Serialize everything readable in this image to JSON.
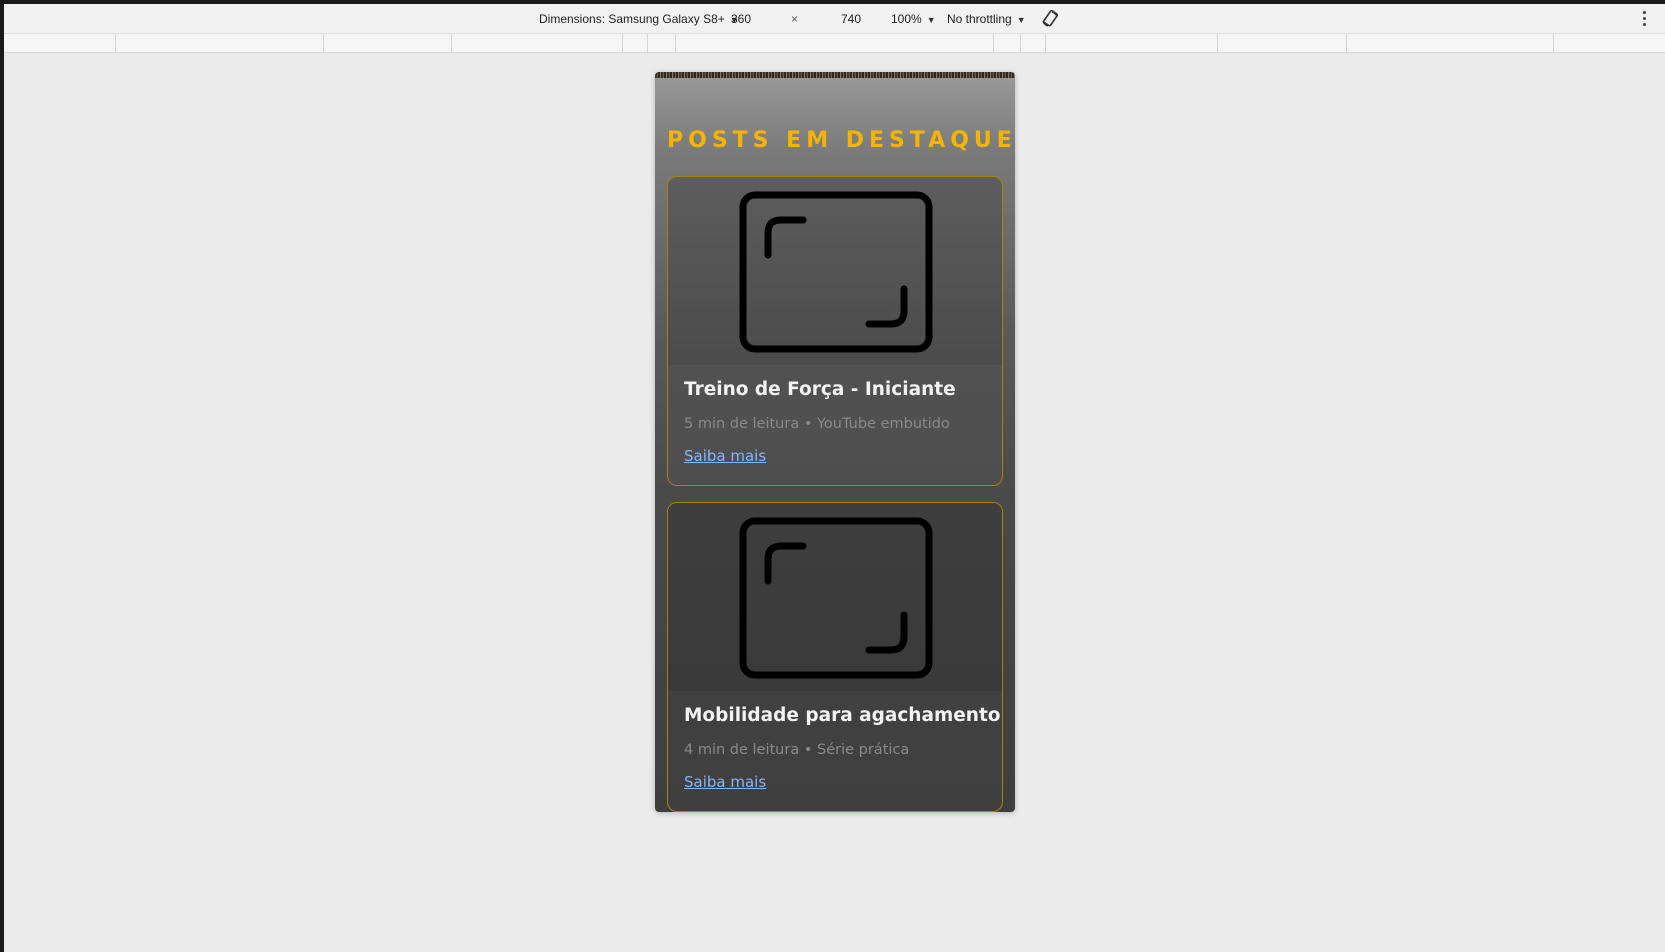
{
  "devtools": {
    "dimensions_label": "Dimensions: Samsung Galaxy S8+",
    "width_value": "360",
    "times": "×",
    "height_value": "740",
    "zoom": "100%",
    "throttling": "No throttling"
  },
  "page": {
    "heading": "POSTS EM DESTAQUE",
    "cards": [
      {
        "title": "Treino de Força - Iniciante",
        "meta": "5 min de leitura • YouTube embutido",
        "link": "Saiba mais"
      },
      {
        "title": "Mobilidade para agachamento",
        "meta": "4 min de leitura • Série prática",
        "link": "Saiba mais"
      }
    ]
  },
  "colors": {
    "accent": "#f4b400",
    "link": "#8ab4f8",
    "card_border": "#a8850a"
  },
  "icons": [
    "chevron-down-icon",
    "rotate-icon",
    "more-vert-icon",
    "image-placeholder-icon"
  ]
}
